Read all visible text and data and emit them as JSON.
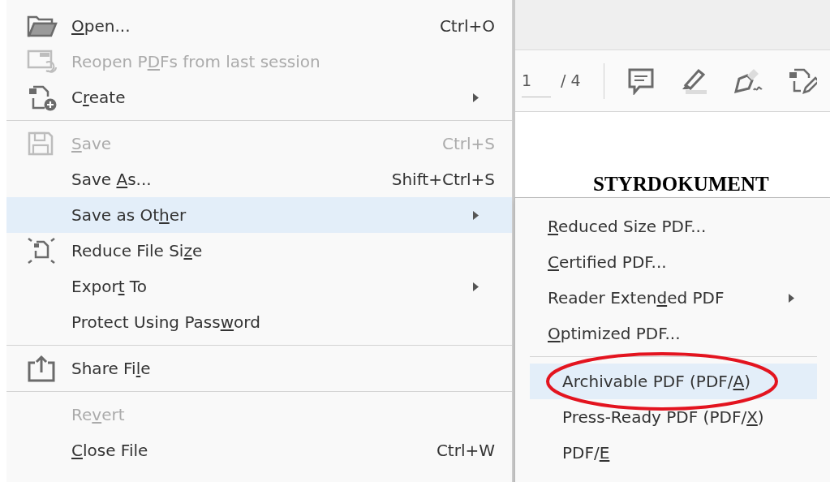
{
  "menu": {
    "groups": [
      {
        "items": [
          {
            "label": {
              "key": "O",
              "post": "pen..."
            },
            "shortcut": "Ctrl+O",
            "disabled": false,
            "selected": false,
            "has_submenu": false
          },
          {
            "label": {
              "pre": "Reopen P",
              "key": "D",
              "post": "Fs from last session"
            },
            "disabled": true,
            "selected": false,
            "has_submenu": false
          },
          {
            "label": {
              "pre": "C",
              "key": "r",
              "post": "eate"
            },
            "disabled": false,
            "selected": false,
            "has_submenu": true
          }
        ]
      },
      {
        "items": [
          {
            "label": {
              "key": "S",
              "post": "ave"
            },
            "shortcut": "Ctrl+S",
            "disabled": true,
            "selected": false,
            "has_submenu": false
          },
          {
            "label": {
              "pre": "Save ",
              "key": "A",
              "post": "s..."
            },
            "shortcut": "Shift+Ctrl+S",
            "disabled": false,
            "selected": false,
            "has_submenu": false
          },
          {
            "label": {
              "pre": "Save as Ot",
              "key": "h",
              "post": "er"
            },
            "disabled": false,
            "selected": true,
            "has_submenu": true
          },
          {
            "label": {
              "pre": "Reduce File Si",
              "key": "z",
              "post": "e"
            },
            "disabled": false,
            "selected": false,
            "has_submenu": false
          },
          {
            "label": {
              "pre": "Expor",
              "key": "t",
              "post": " To"
            },
            "disabled": false,
            "selected": false,
            "has_submenu": true
          },
          {
            "label": {
              "pre": "Protect Using Pass",
              "key": "w",
              "post": "ord"
            },
            "disabled": false,
            "selected": false,
            "has_submenu": false
          }
        ]
      },
      {
        "items": [
          {
            "label": {
              "pre": "Share Fi",
              "key": "l",
              "post": "e"
            },
            "disabled": false,
            "selected": false,
            "has_submenu": false
          }
        ]
      },
      {
        "items": [
          {
            "label": {
              "pre": "Re",
              "key": "v",
              "post": "ert"
            },
            "disabled": true,
            "selected": false,
            "has_submenu": false
          },
          {
            "label": {
              "key": "C",
              "post": "lose File"
            },
            "shortcut": "Ctrl+W",
            "disabled": false,
            "selected": false,
            "has_submenu": false
          }
        ]
      }
    ]
  },
  "toolbar": {
    "page_field": "1",
    "page_total": "/ 4"
  },
  "document": {
    "heading": "STYRDOKUMENT"
  },
  "submenu": {
    "groups": [
      {
        "items": [
          {
            "label": {
              "key": "R",
              "post": "educed Size PDF..."
            },
            "selected": false,
            "has_submenu": false,
            "circled": false
          },
          {
            "label": {
              "key": "C",
              "post": "ertified PDF..."
            },
            "selected": false,
            "has_submenu": false,
            "circled": false
          },
          {
            "label": {
              "pre": "Reader Exten",
              "key": "d",
              "post": "ed PDF"
            },
            "selected": false,
            "has_submenu": true,
            "circled": false
          },
          {
            "label": {
              "key": "O",
              "post": "ptimized PDF..."
            },
            "selected": false,
            "has_submenu": false,
            "circled": false
          }
        ]
      },
      {
        "items": [
          {
            "label": {
              "pre": "Archivable PDF (PDF/",
              "key": "A",
              "post": ")"
            },
            "selected": true,
            "has_submenu": false,
            "circled": true
          },
          {
            "label": {
              "pre": "Press-Ready PDF (PDF/",
              "key": "X",
              "post": ")"
            },
            "selected": false,
            "has_submenu": false,
            "circled": false
          },
          {
            "label": {
              "pre": "PDF/",
              "key": "E"
            },
            "selected": false,
            "has_submenu": false,
            "circled": false
          }
        ]
      }
    ]
  }
}
